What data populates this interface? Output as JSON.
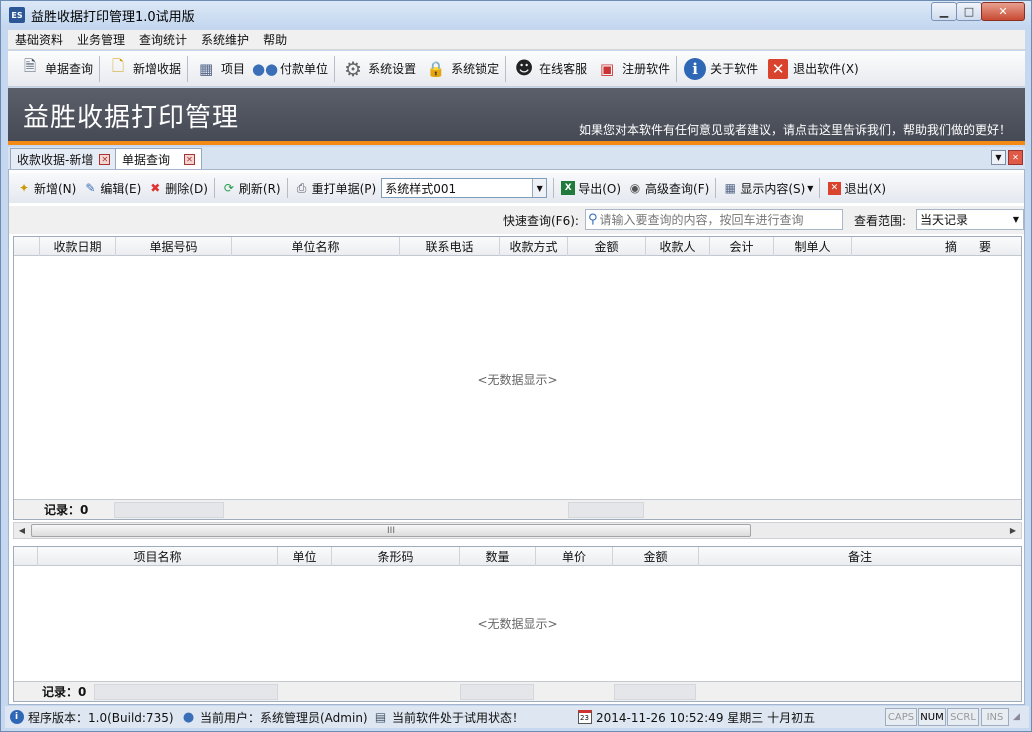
{
  "window": {
    "title": "益胜收据打印管理1.0试用版",
    "logo_text": "ES",
    "minimize": "▁",
    "maximize": "□",
    "close": "✕"
  },
  "menu": [
    "基础资料",
    "业务管理",
    "查询统计",
    "系统维护",
    "帮助"
  ],
  "toolbar": [
    {
      "label": "单据查询",
      "icon": "document-search-icon"
    },
    {
      "label": "新增收据",
      "icon": "new-document-icon"
    },
    {
      "label": "项目",
      "icon": "table-icon"
    },
    {
      "label": "付款单位",
      "icon": "users-icon"
    },
    {
      "label": "系统设置",
      "icon": "gear-icon"
    },
    {
      "label": "系统锁定",
      "icon": "lock-icon"
    },
    {
      "label": "在线客服",
      "icon": "qq-penguin-icon"
    },
    {
      "label": "注册软件",
      "icon": "basket-icon"
    },
    {
      "label": "关于软件",
      "icon": "info-icon"
    },
    {
      "label": "退出软件(X)",
      "icon": "exit-icon"
    }
  ],
  "banner": {
    "title": "益胜收据打印管理",
    "note": "如果您对本软件有任何意见或者建议，请点击这里告诉我们，帮助我们做的更好！"
  },
  "tabs": [
    {
      "label": "收款收据-新增",
      "active": false
    },
    {
      "label": "单据查询",
      "active": true
    }
  ],
  "subtoolbar": {
    "new": "新增(N)",
    "edit": "编辑(E)",
    "delete": "删除(D)",
    "refresh": "刷新(R)",
    "reprint": "重打单据(P)",
    "style_value": "系统样式001",
    "export": "导出(O)",
    "advanced": "高级查询(F)",
    "display": "显示内容(S)",
    "exit": "退出(X)"
  },
  "query": {
    "label": "快速查询(F6):",
    "placeholder": "请输入要查询的内容，按回车进行查询",
    "range_label": "查看范围:",
    "range_value": "当天记录"
  },
  "grid1": {
    "columns": [
      "",
      "收款日期",
      "单据号码",
      "单位名称",
      "联系电话",
      "收款方式",
      "金额",
      "收款人",
      "会计",
      "制单人",
      "",
      "摘要"
    ],
    "empty": "<无数据显示>",
    "record_label": "记录：",
    "record_count": "0"
  },
  "grid2": {
    "columns": [
      "",
      "项目名称",
      "单位",
      "条形码",
      "数量",
      "单价",
      "金额",
      "备注"
    ],
    "empty": "<无数据显示>",
    "record_label": "记录：",
    "record_count": "0"
  },
  "scroll": {
    "thumb_grip": "III"
  },
  "status": {
    "version": "程序版本：1.0(Build:735)",
    "user": "当前用户：系统管理员(Admin)",
    "trial": "当前软件处于试用状态！",
    "datetime": "2014-11-26 10:52:49  星期三  十月初五",
    "calendar_day": "23",
    "caps": "CAPS",
    "num": "NUM",
    "scrl": "SCRL",
    "ins": "INS"
  }
}
